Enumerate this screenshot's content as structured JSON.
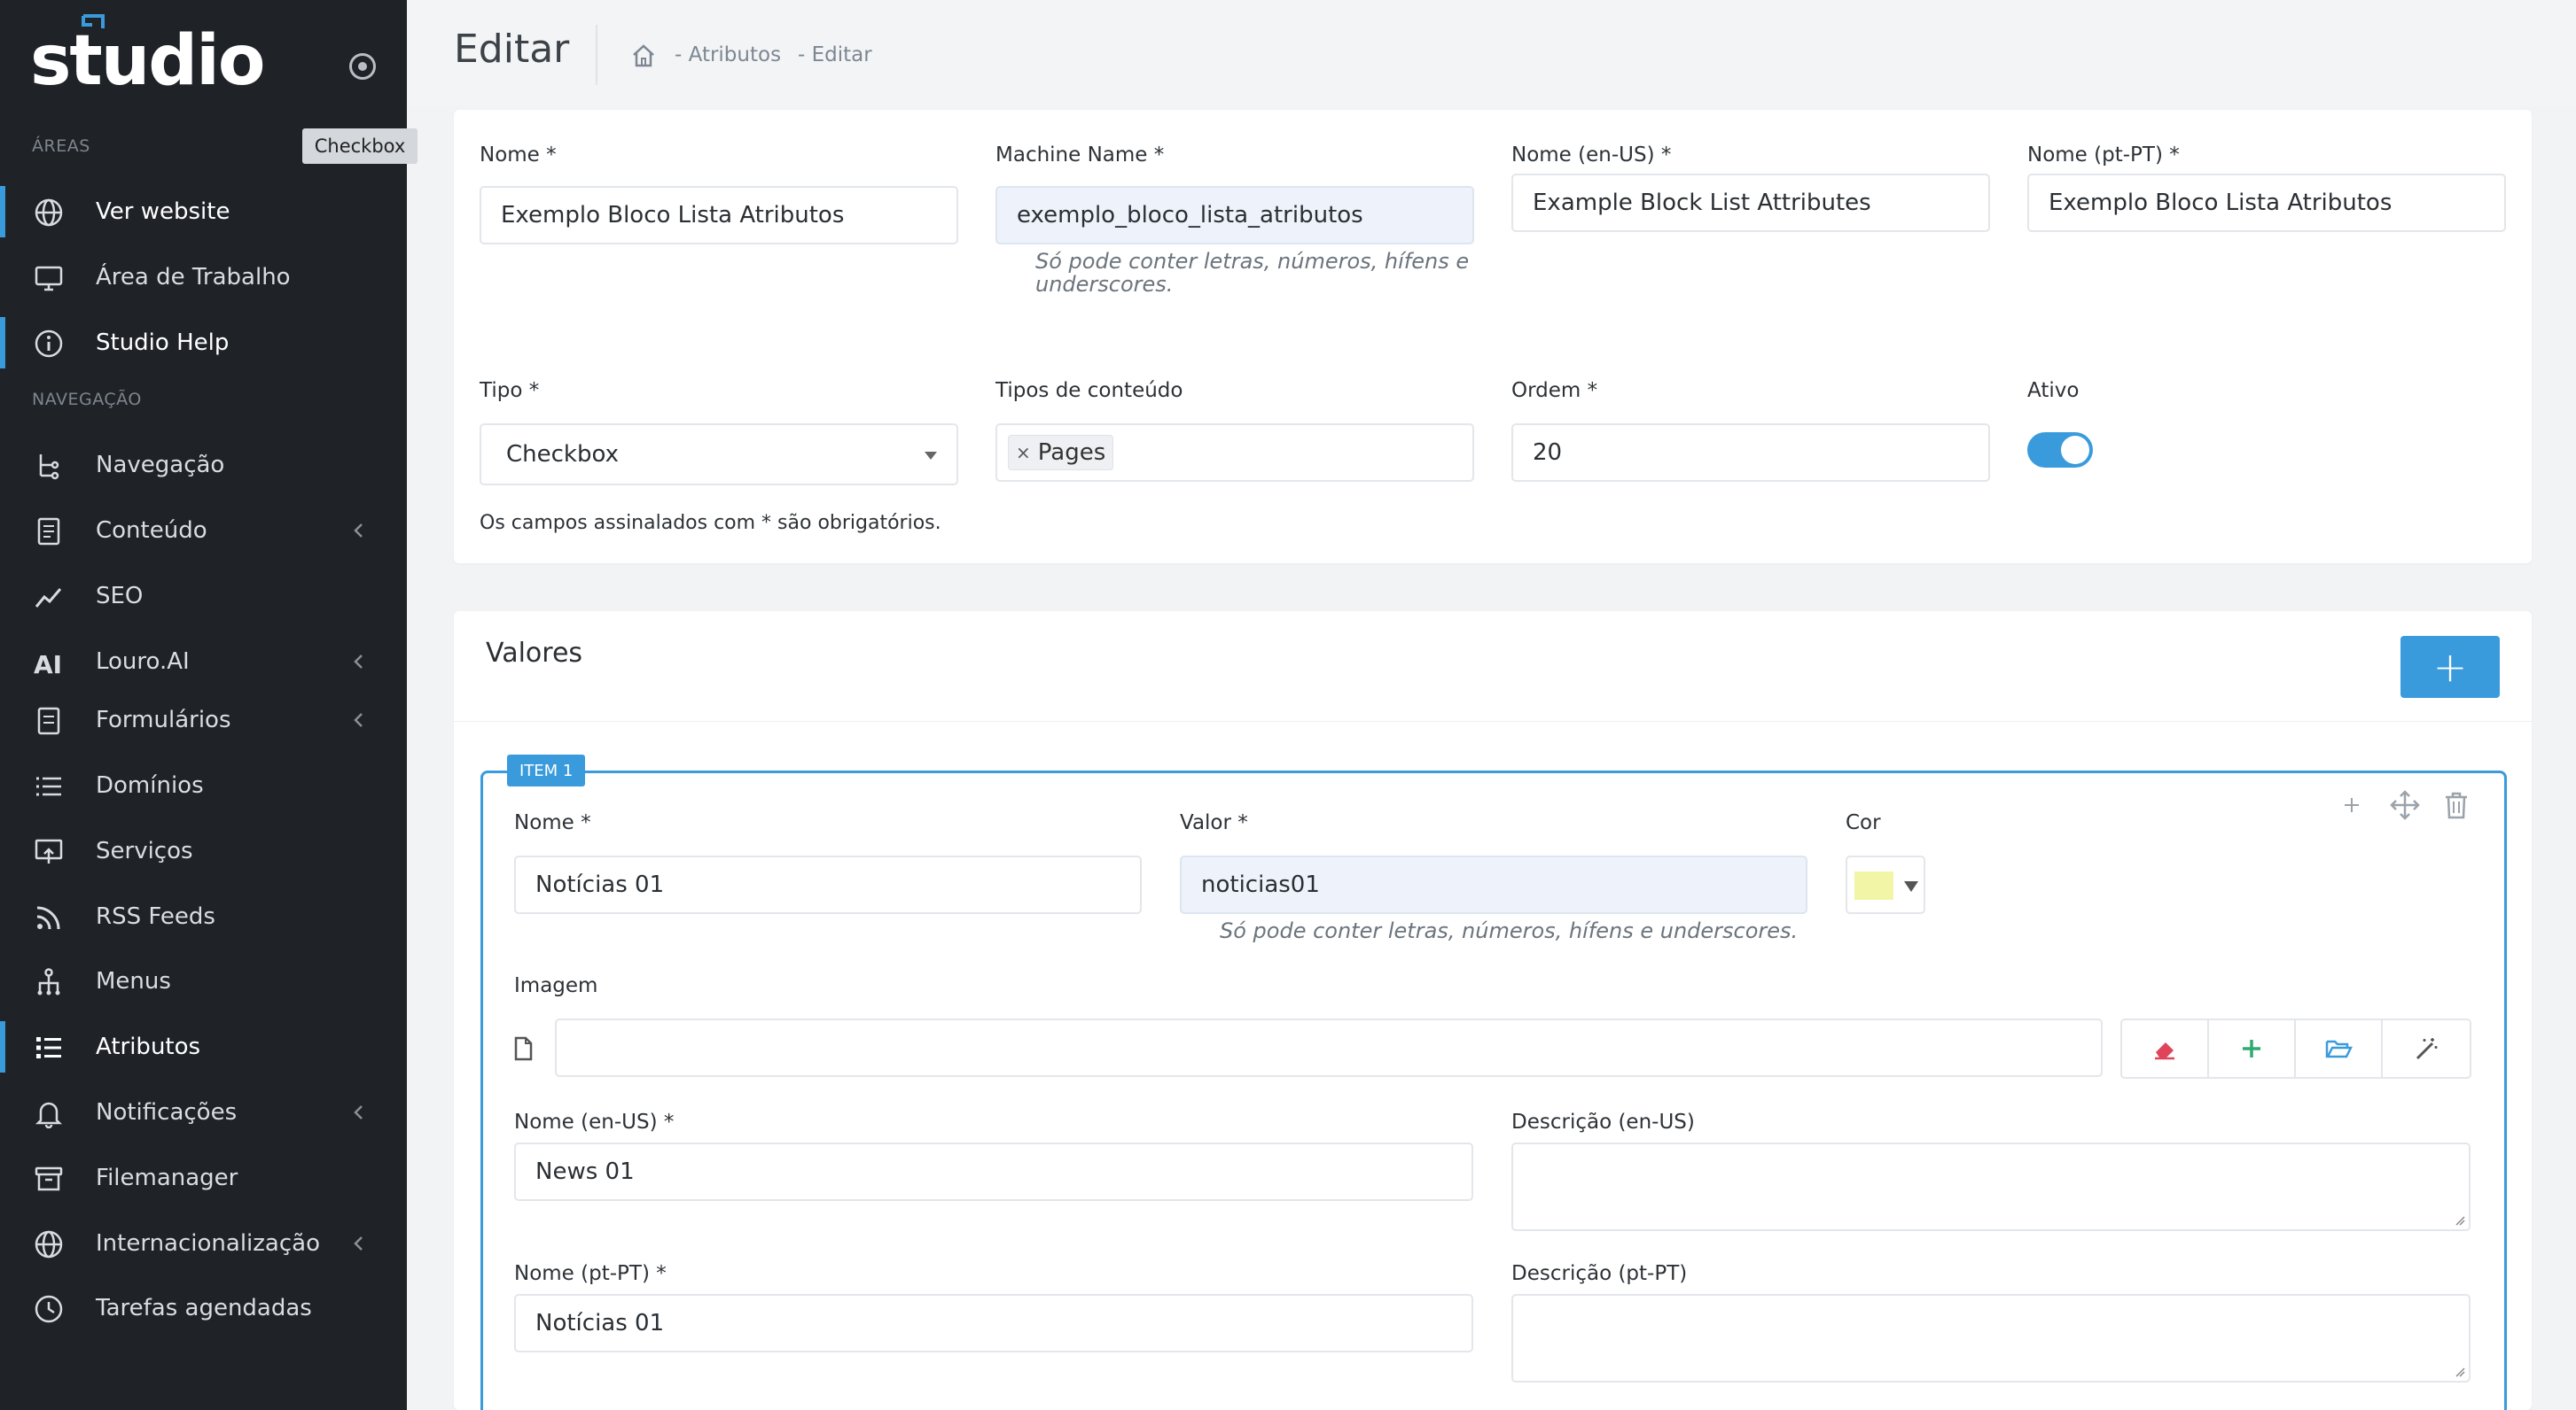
{
  "brand": {
    "name": "studio"
  },
  "tooltip": "Checkbox",
  "sidebar": {
    "areas_label": "ÁREAS",
    "areas": [
      {
        "label": "Ver website",
        "icon": "globe-icon",
        "active": true
      },
      {
        "label": "Área de Trabalho",
        "icon": "monitor-icon",
        "active": false
      },
      {
        "label": "Studio Help",
        "icon": "info-icon",
        "active": true
      }
    ],
    "nav_label": "NAVEGAÇÃO",
    "nav": [
      {
        "label": "Navegação",
        "icon": "tree-icon",
        "chevron": false
      },
      {
        "label": "Conteúdo",
        "icon": "document-icon",
        "chevron": true
      },
      {
        "label": "SEO",
        "icon": "trend-icon",
        "chevron": false
      },
      {
        "label": "Louro.AI",
        "icon": "ai-icon",
        "chevron": true
      },
      {
        "label": "Formulários",
        "icon": "form-icon",
        "chevron": true
      },
      {
        "label": "Domínios",
        "icon": "list-icon",
        "chevron": false
      },
      {
        "label": "Serviços",
        "icon": "services-icon",
        "chevron": false
      },
      {
        "label": "RSS Feeds",
        "icon": "rss-icon",
        "chevron": false
      },
      {
        "label": "Menus",
        "icon": "sitemap-icon",
        "chevron": false
      },
      {
        "label": "Atributos",
        "icon": "attributes-icon",
        "chevron": false,
        "active": true
      },
      {
        "label": "Notificações",
        "icon": "bell-icon",
        "chevron": true
      },
      {
        "label": "Filemanager",
        "icon": "archive-icon",
        "chevron": false
      },
      {
        "label": "Internacionalização",
        "icon": "globe-icon",
        "chevron": true
      },
      {
        "label": "Tarefas agendadas",
        "icon": "clock-icon",
        "chevron": false
      }
    ]
  },
  "header": {
    "title": "Editar",
    "breadcrumb": [
      "- Atributos",
      "- Editar"
    ]
  },
  "form": {
    "nome_label": "Nome *",
    "nome_value": "Exemplo Bloco Lista Atributos",
    "machine_label": "Machine Name *",
    "machine_value": "exemplo_bloco_lista_atributos",
    "machine_help": "Só pode conter letras, números, hífens e underscores.",
    "nome_en_label": "Nome (en-US) *",
    "nome_en_value": "Example Block List Attributes",
    "nome_pt_label": "Nome (pt-PT) *",
    "nome_pt_value": "Exemplo Bloco Lista Atributos",
    "tipo_label": "Tipo *",
    "tipo_value": "Checkbox",
    "tipos_label": "Tipos de conteúdo",
    "tipos_tags": [
      "Pages"
    ],
    "ordem_label": "Ordem *",
    "ordem_value": "20",
    "ativo_label": "Ativo",
    "ativo_value": true,
    "required_note": "Os campos assinalados com * são obrigatórios."
  },
  "valores": {
    "title": "Valores",
    "add_label": "+",
    "item": {
      "badge": "ITEM  1",
      "nome_label": "Nome *",
      "nome_value": "Notícias 01",
      "valor_label": "Valor *",
      "valor_value": "noticias01",
      "valor_help": "Só pode conter letras, números, hífens e underscores.",
      "cor_label": "Cor",
      "cor_value": "#f3f5a6",
      "imagem_label": "Imagem",
      "imagem_value": "",
      "nome_en_label": "Nome (en-US) *",
      "nome_en_value": "News 01",
      "desc_en_label": "Descrição (en-US)",
      "nome_pt_label": "Nome (pt-PT) *",
      "nome_pt_value": "Notícias 01",
      "desc_pt_label": "Descrição (pt-PT)"
    }
  },
  "colors": {
    "accent": "#3a9bdc",
    "sidebar": "#1f2328",
    "danger": "#e0445a",
    "success": "#2eaa72"
  }
}
